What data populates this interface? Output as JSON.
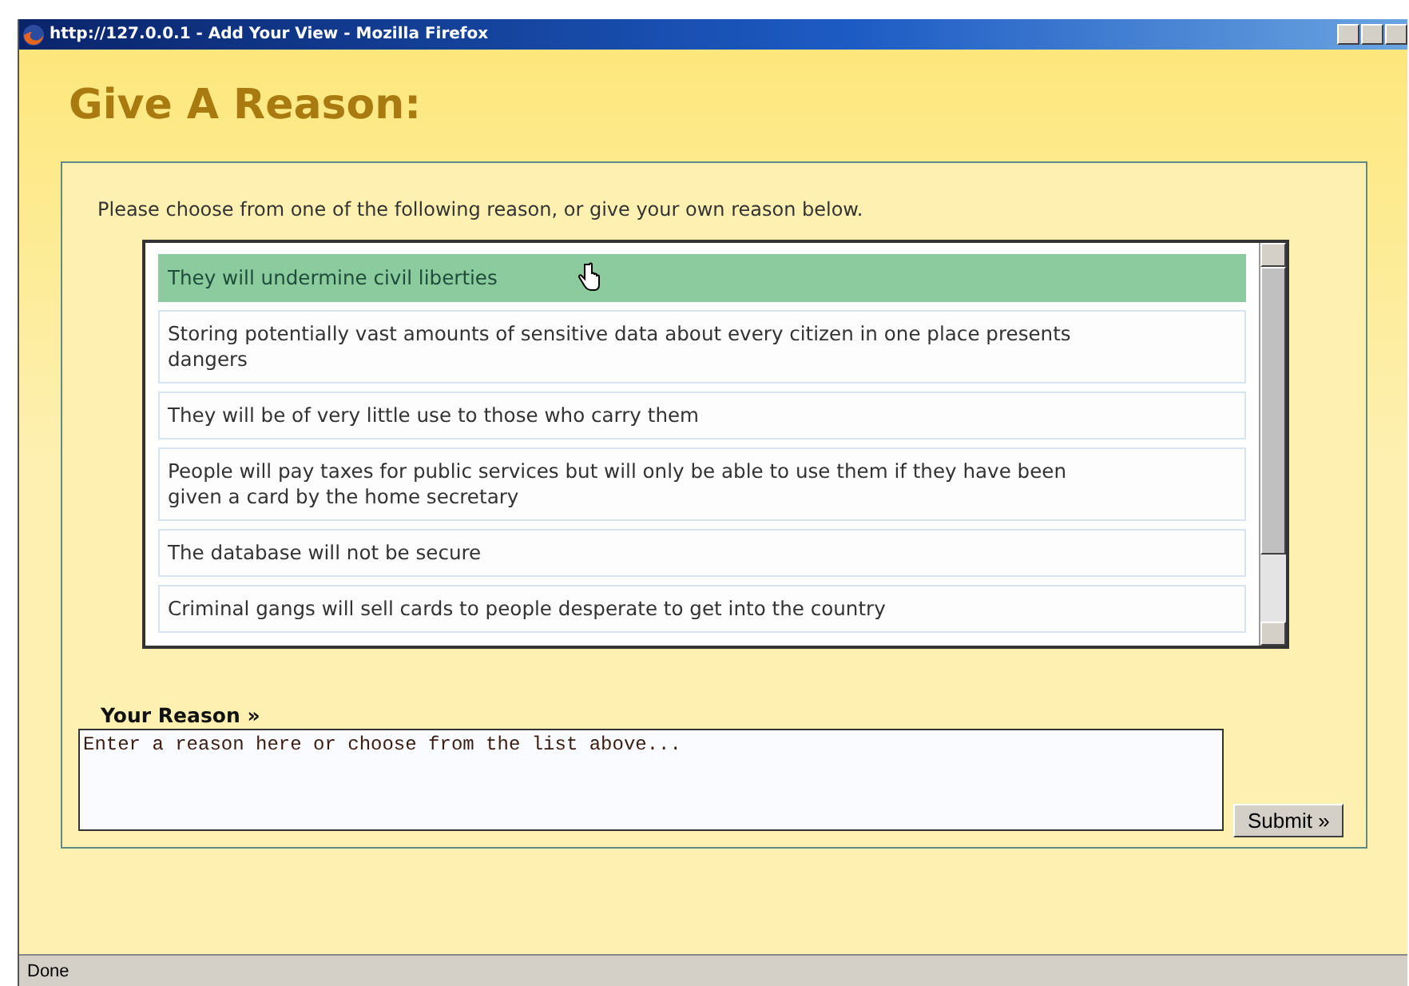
{
  "window": {
    "title": "http://127.0.0.1 - Add Your View - Mozilla Firefox"
  },
  "heading": "Give A Reason:",
  "instruction": "Please choose from one of the following reason, or give your own reason below.",
  "reasons": [
    {
      "text": "They will undermine civil liberties",
      "selected": true
    },
    {
      "text": "Storing potentially vast amounts of sensitive data about every citizen in one place presents dangers",
      "selected": false
    },
    {
      "text": "They will be of very little use to those who carry them",
      "selected": false
    },
    {
      "text": "People will pay taxes for public services but will only be able to use them if they have been given a card by the home secretary",
      "selected": false
    },
    {
      "text": "The database will not be secure",
      "selected": false
    },
    {
      "text": "Criminal gangs will sell cards to people desperate to get into the country",
      "selected": false
    }
  ],
  "reason_field": {
    "label": "Your Reason »",
    "placeholder": "Enter a reason here or choose from the list above..."
  },
  "submit_button": "Submit »",
  "status_bar": "Done"
}
